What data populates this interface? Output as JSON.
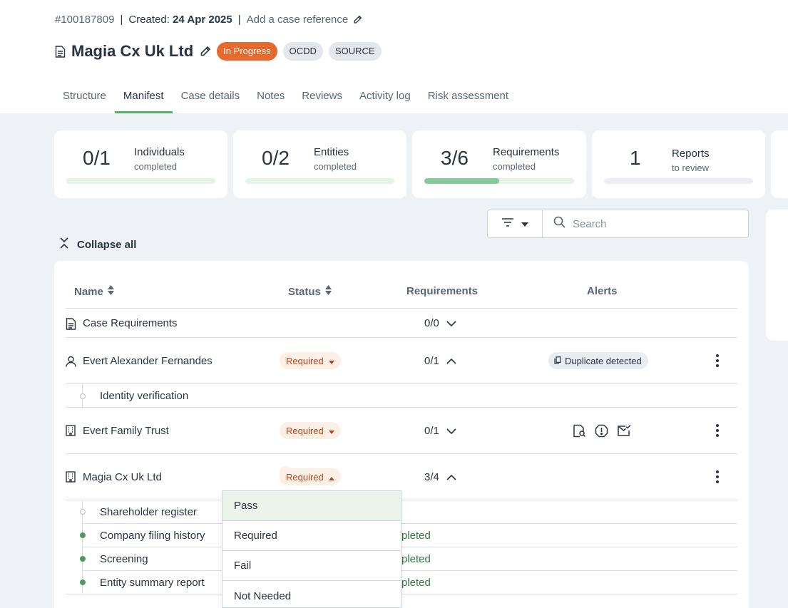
{
  "header": {
    "case_id": "#100187809",
    "created_label": "Created:",
    "created_date": "24 Apr 2025",
    "add_reference": "Add a case reference",
    "title": "Magia Cx Uk Ltd",
    "status": "In Progress",
    "tags": [
      "OCDD",
      "SOURCE"
    ]
  },
  "tabs": [
    {
      "label": "Structure"
    },
    {
      "label": "Manifest",
      "active": true
    },
    {
      "label": "Case details"
    },
    {
      "label": "Notes"
    },
    {
      "label": "Reviews"
    },
    {
      "label": "Activity log"
    },
    {
      "label": "Risk assessment"
    }
  ],
  "stats": [
    {
      "value": "0/1",
      "label": "Individuals",
      "sub": "completed",
      "progress": 0
    },
    {
      "value": "0/2",
      "label": "Entities",
      "sub": "completed",
      "progress": 0
    },
    {
      "value": "3/6",
      "label": "Requirements",
      "sub": "completed",
      "progress": 0.5
    },
    {
      "value": "1",
      "label": "Reports",
      "sub": "to review",
      "progress": 0
    }
  ],
  "search": {
    "placeholder": "Search"
  },
  "collapse_label": "Collapse all",
  "table": {
    "columns": {
      "name": "Name",
      "status": "Status",
      "requirements": "Requirements",
      "alerts": "Alerts"
    },
    "rows": [
      {
        "name": "Case Requirements",
        "icon": "document-icon",
        "requirements": "0/0",
        "expanded": false
      },
      {
        "name": "Evert Alexander Fernandes",
        "icon": "person-icon",
        "status": "Required",
        "requirements": "0/1",
        "expanded": true,
        "alert": "Duplicate detected",
        "children": [
          {
            "name": "Identity verification",
            "completed": false
          }
        ]
      },
      {
        "name": "Evert Family Trust",
        "icon": "building-icon",
        "status": "Required",
        "requirements": "0/1",
        "expanded": false,
        "alert_icons": [
          "document-search-icon",
          "warning-octagon-icon",
          "mail-check-icon"
        ]
      },
      {
        "name": "Magia Cx Uk Ltd",
        "icon": "building-icon",
        "status": "Required",
        "requirements": "3/4",
        "expanded": true,
        "children": [
          {
            "name": "Shareholder register",
            "completed": false
          },
          {
            "name": "Company filing history",
            "completed": true,
            "status_text": "pleted"
          },
          {
            "name": "Screening",
            "completed": true,
            "status_text": "pleted"
          },
          {
            "name": "Entity summary report",
            "completed": true,
            "status_text": "pleted"
          }
        ]
      }
    ]
  },
  "status_dropdown": {
    "options": [
      "Pass",
      "Required",
      "Fail",
      "Not Needed"
    ],
    "highlighted": "Pass"
  },
  "colors": {
    "accent_green": "#56b16d",
    "in_progress": "#e46a2e",
    "required_text": "#b8461b",
    "required_bg": "#fcefe6",
    "completed_text": "#2f7a3d"
  }
}
